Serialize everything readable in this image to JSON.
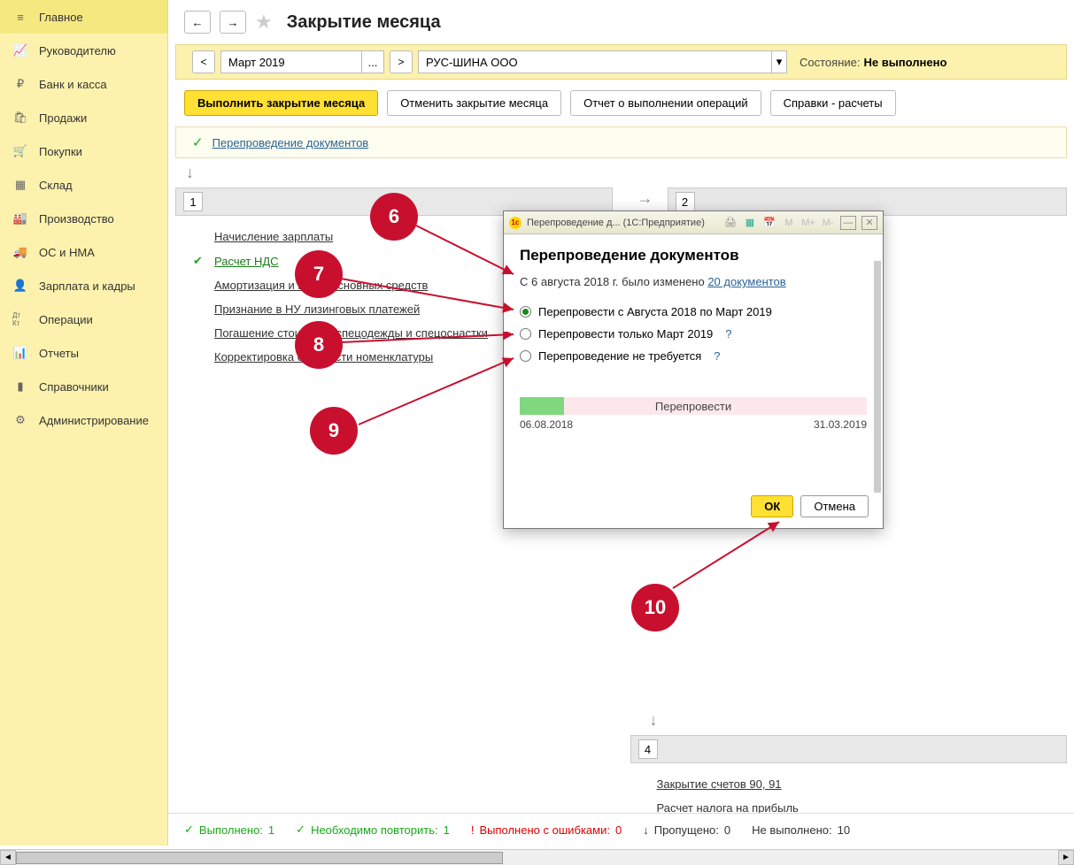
{
  "sidebar": {
    "items": [
      {
        "label": "Главное",
        "icon": "≡"
      },
      {
        "label": "Руководителю",
        "icon": "📈"
      },
      {
        "label": "Банк и касса",
        "icon": "₽"
      },
      {
        "label": "Продажи",
        "icon": "🛍"
      },
      {
        "label": "Покупки",
        "icon": "🛒"
      },
      {
        "label": "Склад",
        "icon": "▦"
      },
      {
        "label": "Производство",
        "icon": "🏭"
      },
      {
        "label": "ОС и НМА",
        "icon": "🚚"
      },
      {
        "label": "Зарплата и кадры",
        "icon": "👤"
      },
      {
        "label": "Операции",
        "icon": "Дт Кт"
      },
      {
        "label": "Отчеты",
        "icon": "📊"
      },
      {
        "label": "Справочники",
        "icon": "▮"
      },
      {
        "label": "Администрирование",
        "icon": "⚙"
      }
    ]
  },
  "header": {
    "title": "Закрытие месяца"
  },
  "period": {
    "month": "Март 2019",
    "org": "РУС-ШИНА ООО",
    "status_label": "Состояние:",
    "status_value": "Не выполнено"
  },
  "actions": {
    "execute": "Выполнить закрытие месяца",
    "cancel": "Отменить закрытие месяца",
    "report": "Отчет о выполнении операций",
    "refs": "Справки - расчеты"
  },
  "repost_link": "Перепроведение документов",
  "section1": {
    "num": "1",
    "ops": [
      {
        "label": "Начисление зарплаты",
        "done": false
      },
      {
        "label": "Расчет НДС",
        "done": true
      },
      {
        "label": "Амортизация и износ основных средств",
        "done": false
      },
      {
        "label": "Признание в НУ лизинговых платежей",
        "done": false
      },
      {
        "label": "Погашение стоимости спецодежды и спецоснастки",
        "done": false
      },
      {
        "label": "Корректировка стоимости номенклатуры",
        "done": false
      }
    ]
  },
  "section2": {
    "num": "2"
  },
  "section4": {
    "num": "4",
    "ops": [
      {
        "label": "Закрытие счетов 90, 91"
      },
      {
        "label": "Расчет налога на прибыль"
      }
    ]
  },
  "statusbar": {
    "done_label": "Выполнено:",
    "done_count": "1",
    "repeat_label": "Необходимо повторить:",
    "repeat_count": "1",
    "errors_label": "Выполнено с ошибками:",
    "errors_count": "0",
    "skipped_label": "Пропущено:",
    "skipped_count": "0",
    "notdone_label": "Не выполнено:",
    "notdone_count": "10"
  },
  "modal": {
    "titlebar": "Перепроведение д...  (1С:Предприятие)",
    "heading": "Перепроведение документов",
    "info_prefix": "С 6 августа 2018 г. было изменено ",
    "info_link": "20 документов",
    "radio1": "Перепровести с Августа 2018 по Март 2019",
    "radio2": "Перепровести только Март 2019",
    "radio3": "Перепроведение не требуется",
    "progress_label": "Перепровести",
    "date_from": "06.08.2018",
    "date_to": "31.03.2019",
    "ok": "ОК",
    "cancel": "Отмена"
  },
  "badges": {
    "b6": "6",
    "b7": "7",
    "b8": "8",
    "b9": "9",
    "b10": "10"
  }
}
